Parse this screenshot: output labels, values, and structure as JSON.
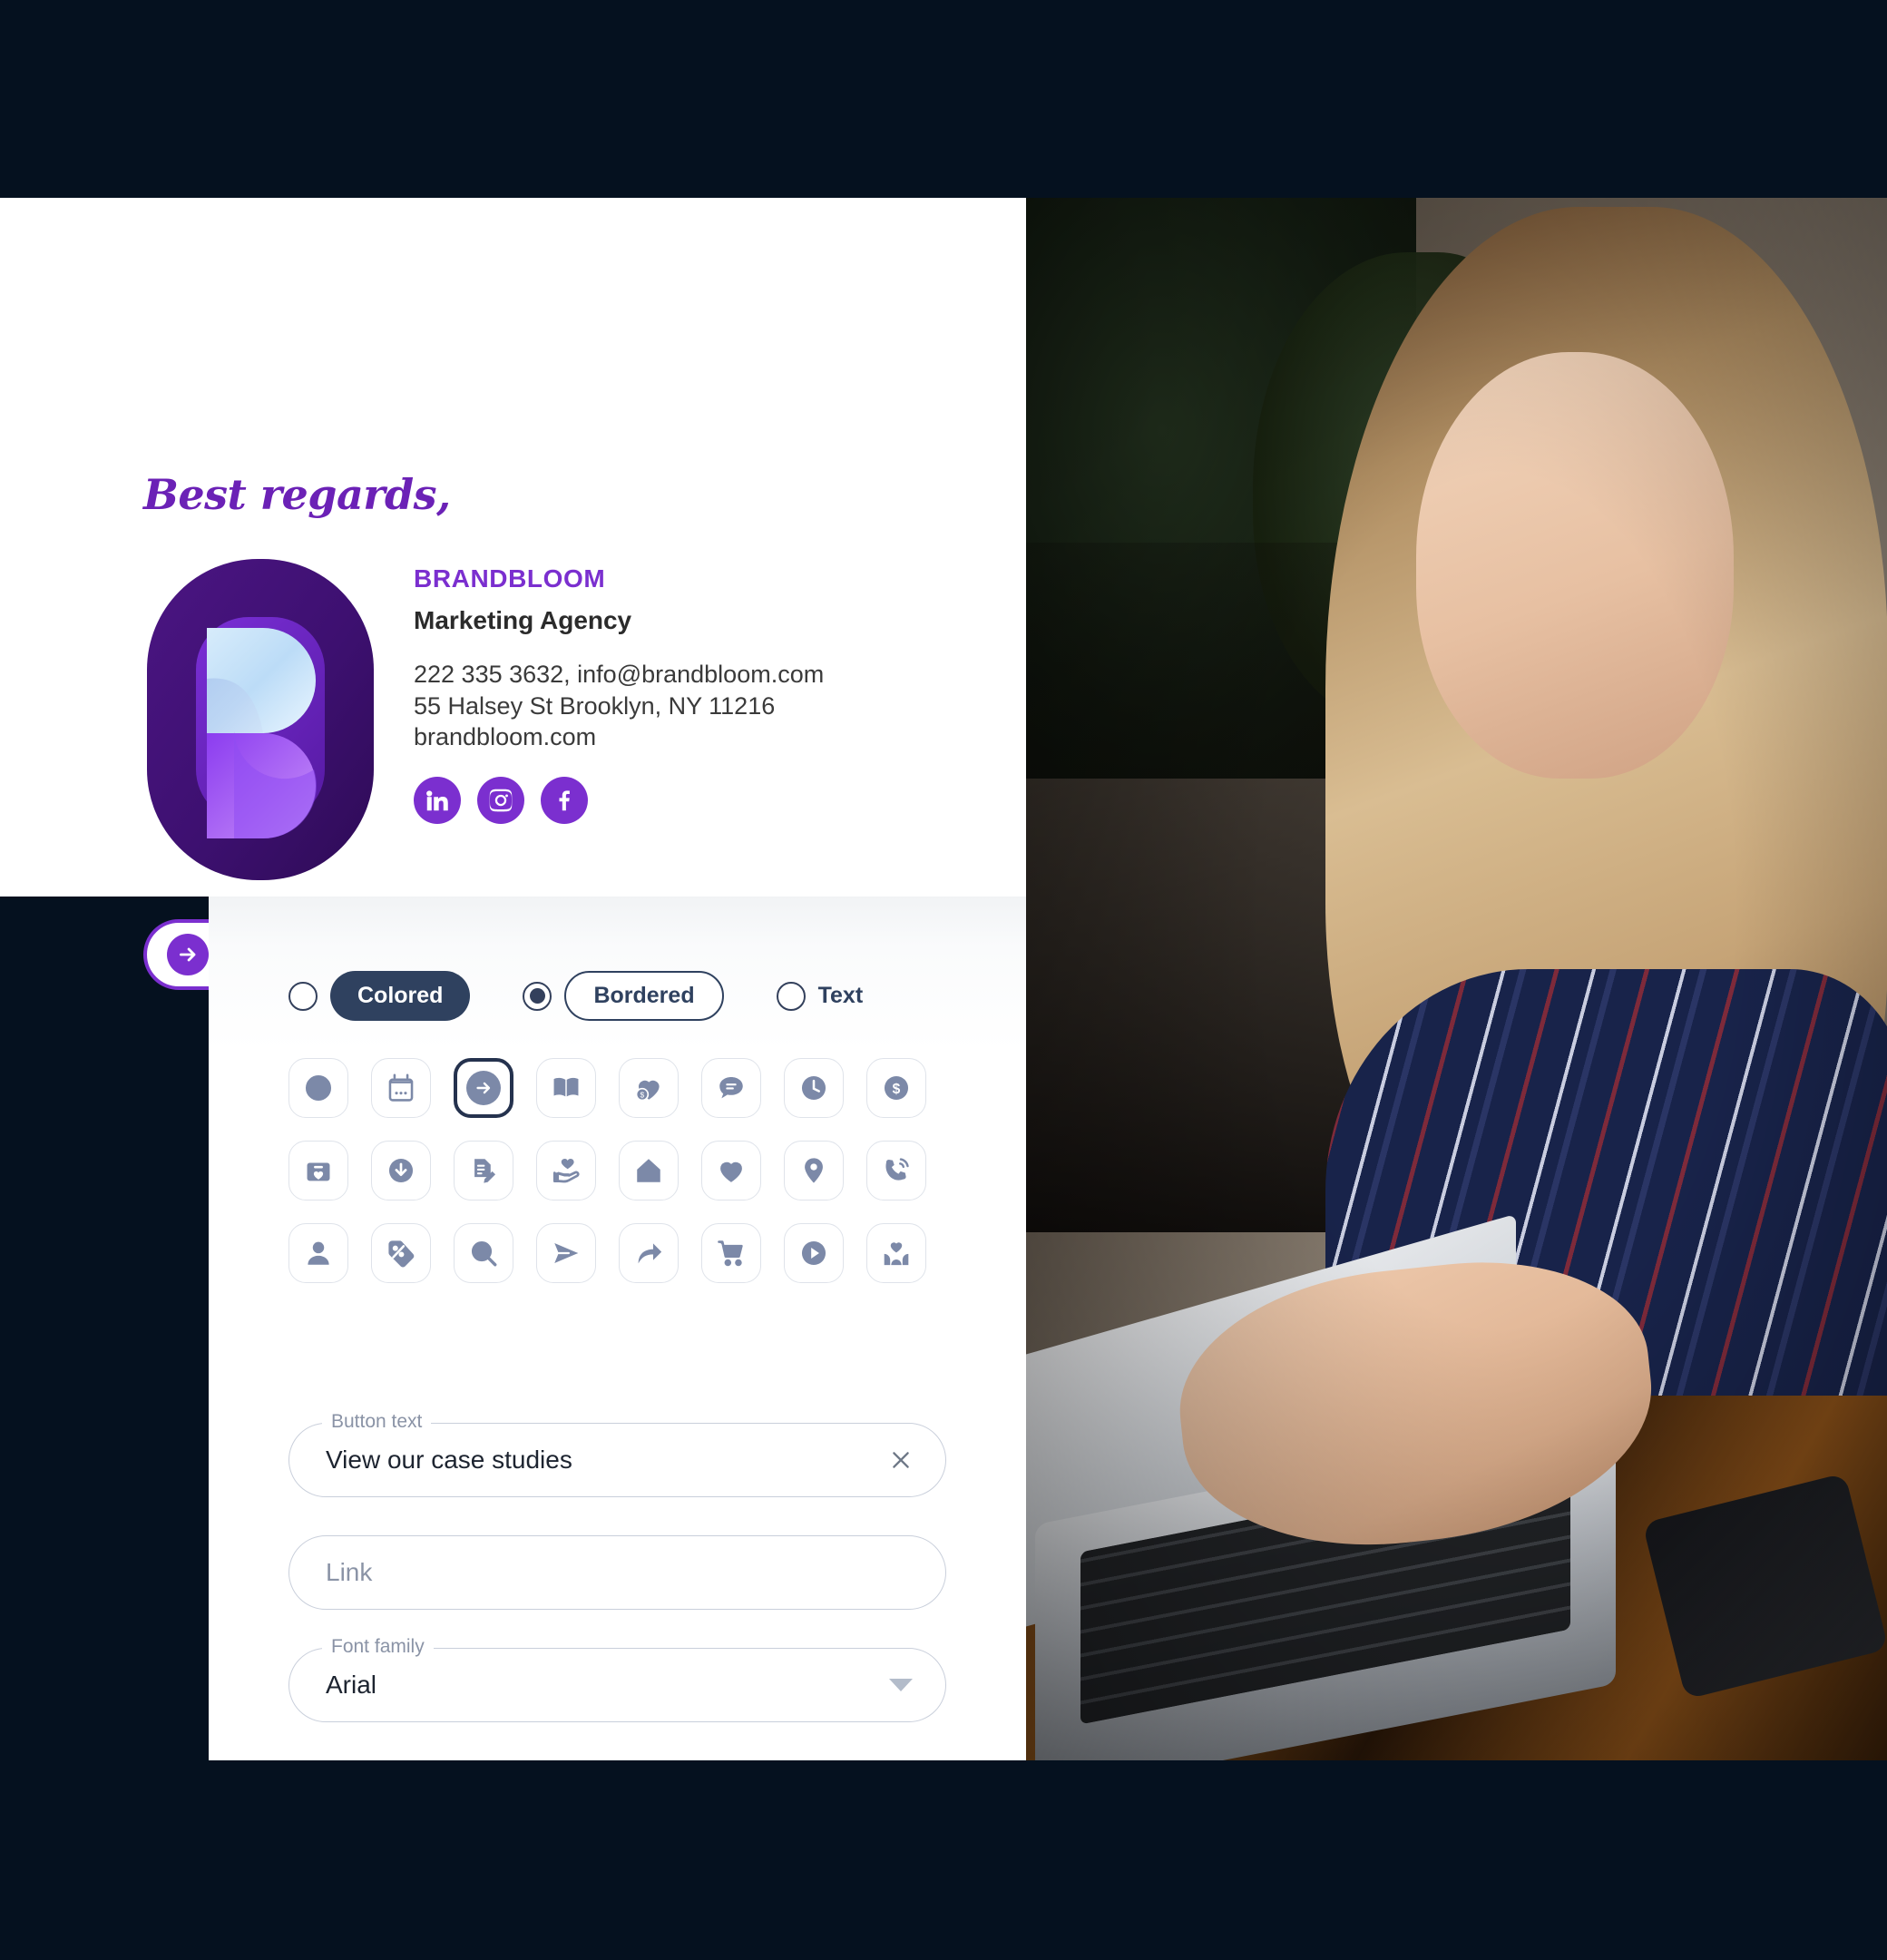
{
  "signature": {
    "greeting": "Best regards,",
    "brand_name": "BRANDBLOOM",
    "brand_role": "Marketing Agency",
    "contact_line_1": "222 335 3632, info@brandbloom.com",
    "contact_line_2": "55 Halsey St Brooklyn, NY 11216",
    "contact_line_3": "brandbloom.com",
    "logo_alt": "brandbloom-logo",
    "socials": [
      {
        "name": "linkedin-icon",
        "label": "LinkedIn"
      },
      {
        "name": "instagram-icon",
        "label": "Instagram"
      },
      {
        "name": "facebook-icon",
        "label": "Facebook"
      }
    ],
    "cta_label": "View our case studies",
    "cta_icon": "arrow-right-circle-icon",
    "accent_color": "#7b2fcf",
    "heading_color": "#6b21b6"
  },
  "editor": {
    "style_options": [
      {
        "label": "Colored",
        "selected": false,
        "variant": "filled"
      },
      {
        "label": "Bordered",
        "selected": true,
        "variant": "outline"
      },
      {
        "label": "Text",
        "selected": false,
        "variant": "plain"
      }
    ],
    "icons": [
      {
        "name": "no-icon",
        "selected": false
      },
      {
        "name": "calendar-icon",
        "selected": false
      },
      {
        "name": "arrow-right-circle-icon",
        "selected": true
      },
      {
        "name": "book-open-icon",
        "selected": false
      },
      {
        "name": "heart-dollar-icon",
        "selected": false
      },
      {
        "name": "chat-bubble-icon",
        "selected": false
      },
      {
        "name": "clock-icon",
        "selected": false
      },
      {
        "name": "dollar-coin-icon",
        "selected": false
      },
      {
        "name": "donation-box-icon",
        "selected": false
      },
      {
        "name": "download-circle-icon",
        "selected": false
      },
      {
        "name": "document-edit-icon",
        "selected": false
      },
      {
        "name": "hand-heart-icon",
        "selected": false
      },
      {
        "name": "home-icon",
        "selected": false
      },
      {
        "name": "heart-icon",
        "selected": false
      },
      {
        "name": "location-pin-icon",
        "selected": false
      },
      {
        "name": "phone-call-icon",
        "selected": false
      },
      {
        "name": "user-icon",
        "selected": false
      },
      {
        "name": "discount-tag-icon",
        "selected": false
      },
      {
        "name": "search-icon",
        "selected": false
      },
      {
        "name": "send-icon",
        "selected": false
      },
      {
        "name": "share-arrow-icon",
        "selected": false
      },
      {
        "name": "shopping-cart-icon",
        "selected": false
      },
      {
        "name": "play-circle-icon",
        "selected": false
      },
      {
        "name": "hands-heart-icon",
        "selected": false
      }
    ],
    "fields": {
      "button_text": {
        "label": "Button text",
        "value": "View our case studies",
        "clear_icon": "close-icon"
      },
      "link": {
        "label": "",
        "value": "",
        "placeholder": "Link"
      },
      "font_family": {
        "label": "Font family",
        "value": "Arial",
        "caret_icon": "chevron-down-icon"
      }
    },
    "selected_color": "#2f415f"
  },
  "photo": {
    "alt": "woman-smiling-typing-on-laptop"
  },
  "page": {
    "background_color": "#05111f"
  }
}
